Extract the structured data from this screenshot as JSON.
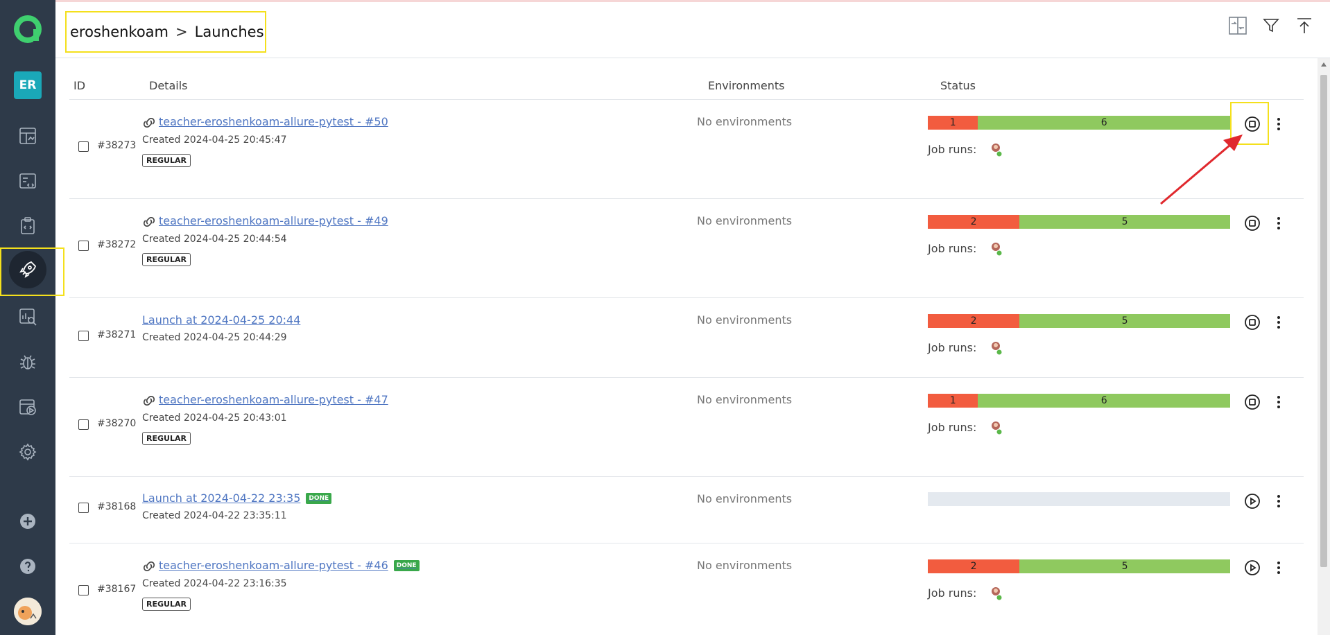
{
  "sidebar": {
    "user_initials": "ER",
    "items": [
      "dashboards-icon",
      "testcases-icon",
      "testplans-icon",
      "launches-icon",
      "analytics-icon",
      "defects-icon",
      "jobs-icon",
      "settings-icon"
    ],
    "bottom": [
      "add-icon",
      "help-icon",
      "user-avatar"
    ]
  },
  "header": {
    "breadcrumb": {
      "project": "eroshenkoam",
      "separator": ">",
      "page": "Launches"
    },
    "icons": [
      "compare-icon",
      "filter-icon",
      "upload-icon"
    ]
  },
  "table": {
    "columns": {
      "id": "ID",
      "details": "Details",
      "environments": "Environments",
      "status": "Status"
    },
    "rows": [
      {
        "id": "#38273",
        "title": "teacher-eroshenkoam-allure-pytest - #50",
        "created": "Created 2024-04-25 20:45:47",
        "tag": "REGULAR",
        "env": "No environments",
        "failed": "1",
        "passed": "6",
        "fail_ratio": 0.166,
        "job_runs": "Job runs:",
        "action": "stop"
      },
      {
        "id": "#38272",
        "title": "teacher-eroshenkoam-allure-pytest - #49",
        "created": "Created 2024-04-25 20:44:54",
        "tag": "REGULAR",
        "env": "No environments",
        "failed": "2",
        "passed": "5",
        "fail_ratio": 0.303,
        "job_runs": "Job runs:",
        "action": "stop"
      },
      {
        "id": "#38271",
        "title": "Launch at 2024-04-25 20:44",
        "created": "Created 2024-04-25 20:44:29",
        "env": "No environments",
        "failed": "2",
        "passed": "5",
        "fail_ratio": 0.303,
        "job_runs": "Job runs:",
        "action": "stop"
      },
      {
        "id": "#38270",
        "title": "teacher-eroshenkoam-allure-pytest - #47",
        "created": "Created 2024-04-25 20:43:01",
        "tag": "REGULAR",
        "env": "No environments",
        "failed": "1",
        "passed": "6",
        "fail_ratio": 0.166,
        "job_runs": "Job runs:",
        "action": "stop"
      },
      {
        "id": "#38168",
        "title": "Launch at 2024-04-22 23:35",
        "done": "DONE",
        "created": "Created 2024-04-22 23:35:11",
        "env": "No environments",
        "action": "play"
      },
      {
        "id": "#38167",
        "title": "teacher-eroshenkoam-allure-pytest - #46",
        "done": "DONE",
        "created": "Created 2024-04-22 23:16:35",
        "tag": "REGULAR",
        "env": "No environments",
        "failed": "2",
        "passed": "5",
        "fail_ratio": 0.303,
        "job_runs": "Job runs:",
        "action": "play"
      }
    ]
  },
  "colors": {
    "sidebar": "#2e3a49",
    "accent_teal": "#1aa8b8",
    "failed": "#f25c3f",
    "passed": "#8fc95f",
    "link": "#4f76c2",
    "highlight": "#f4e01c",
    "arrow": "#e0282d"
  }
}
